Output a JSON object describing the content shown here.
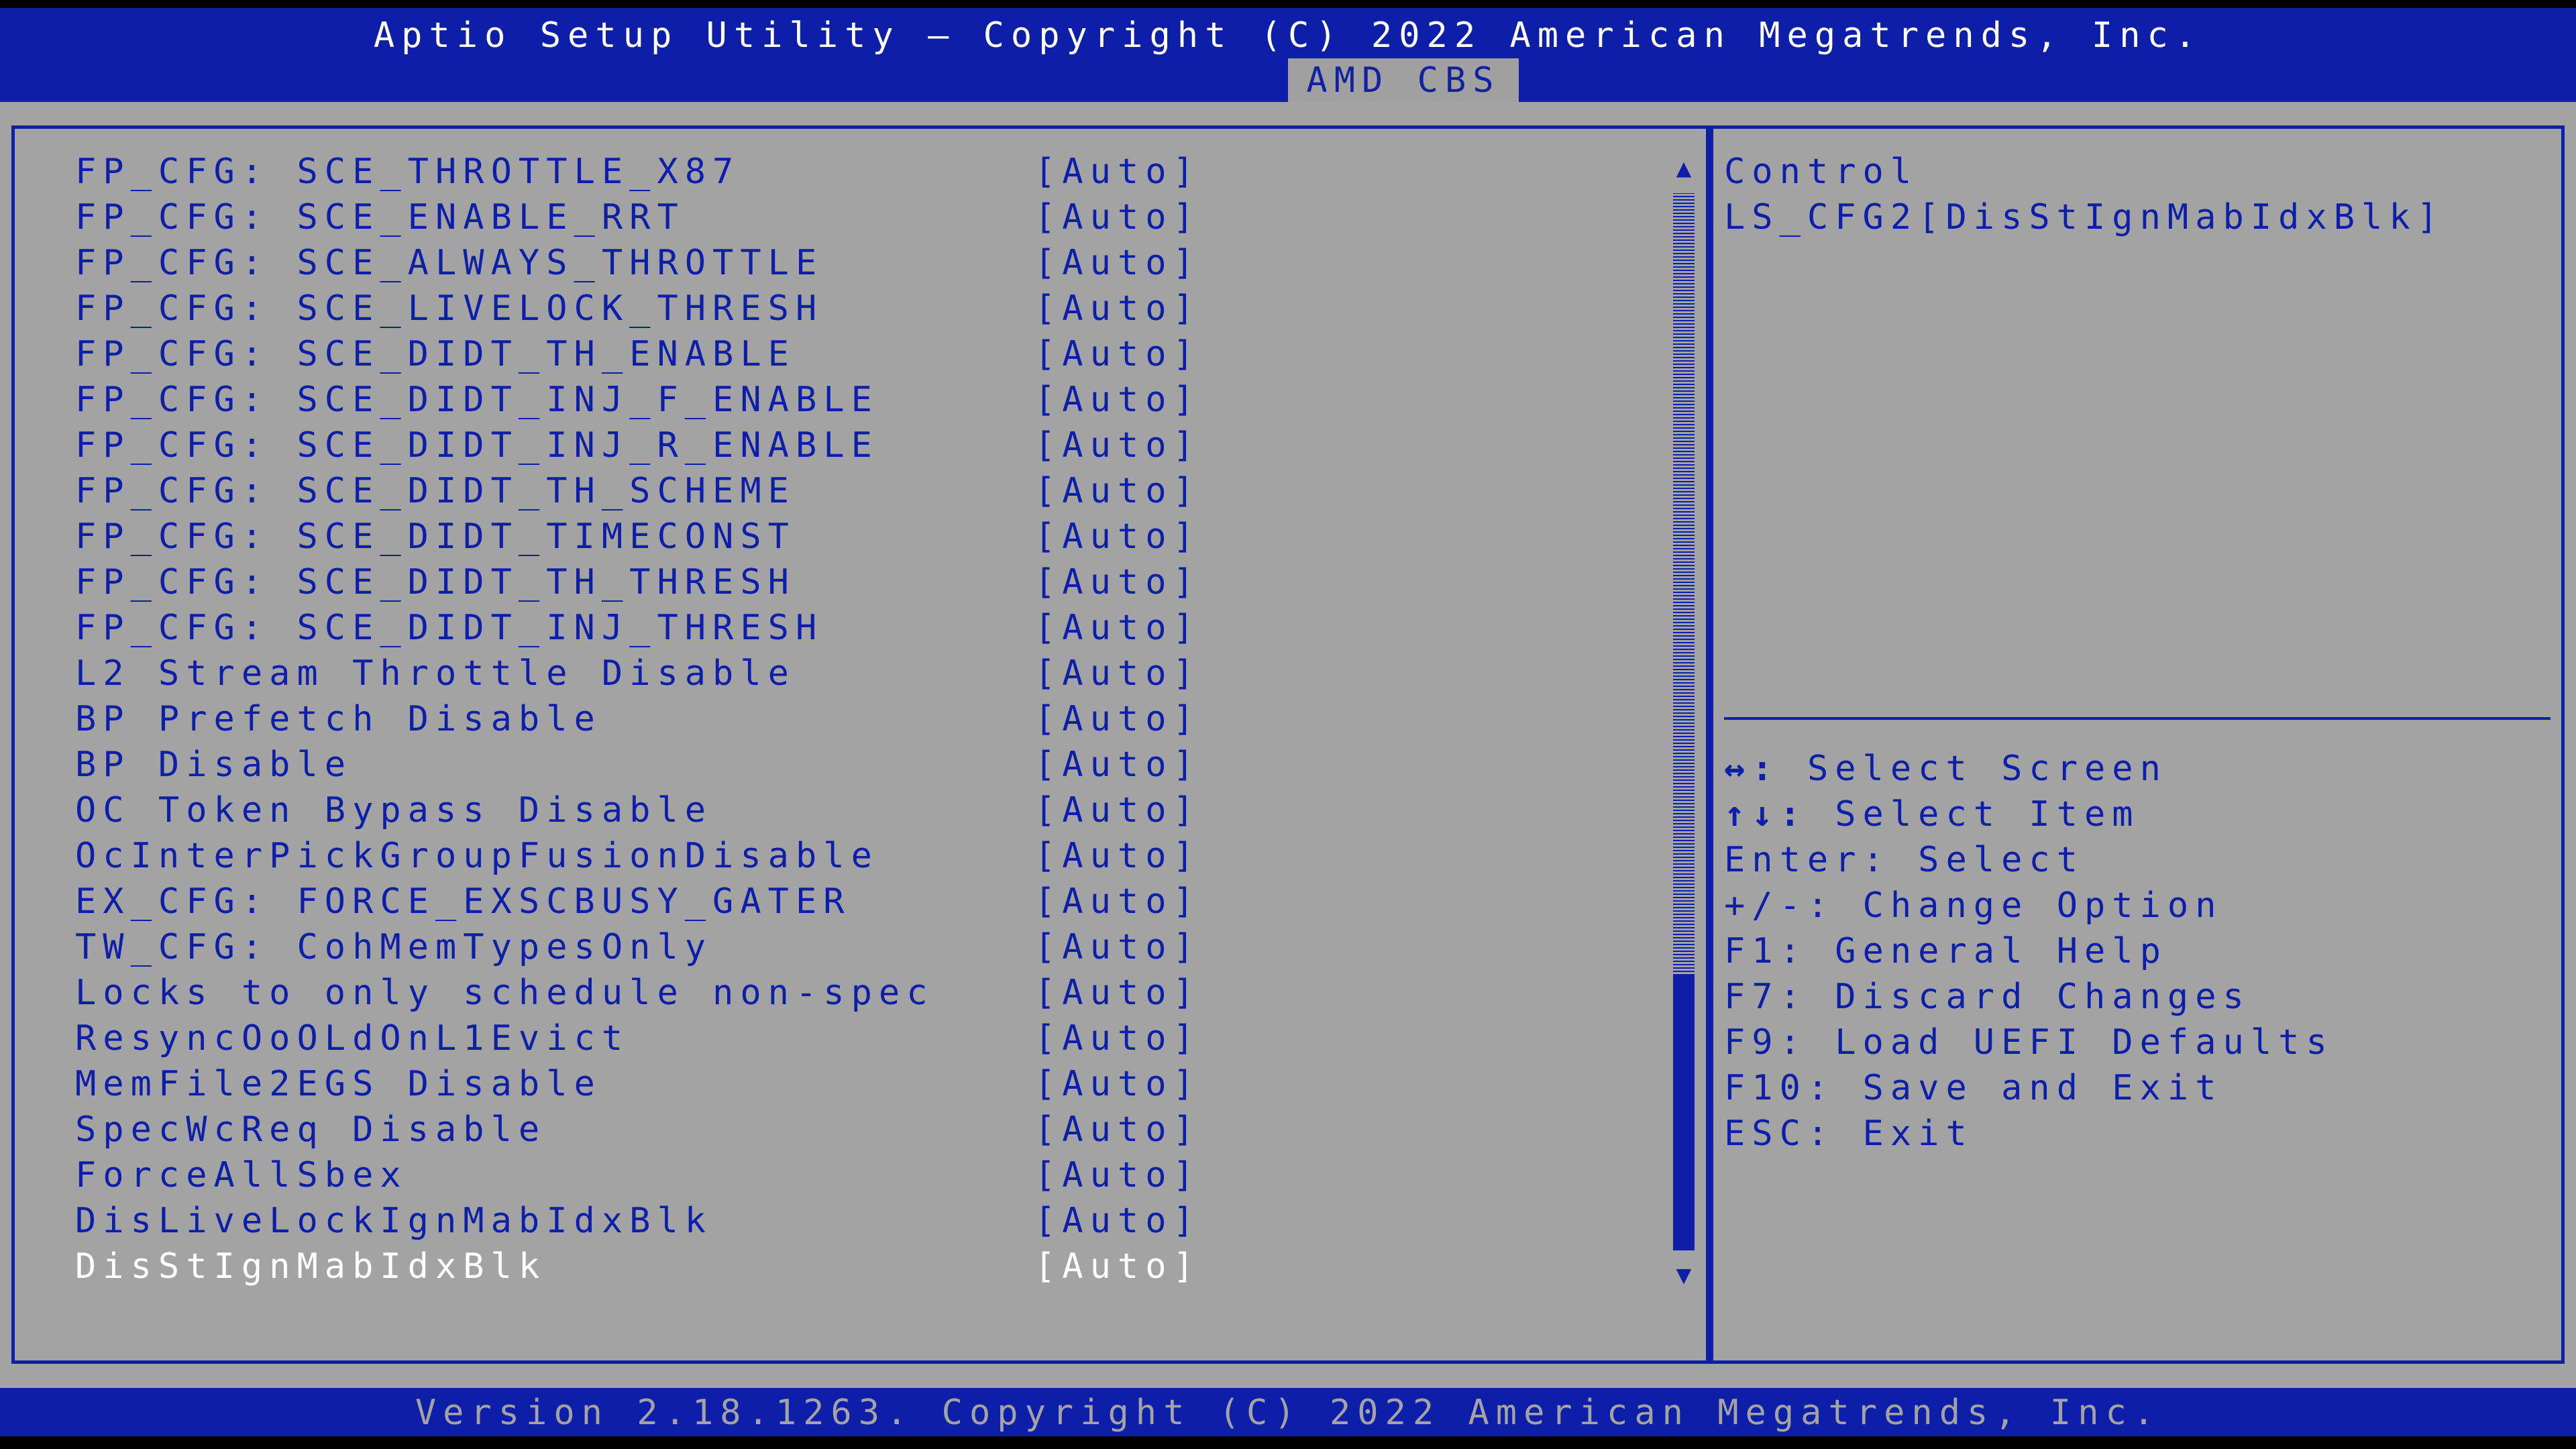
{
  "header": {
    "title": "Aptio Setup Utility – Copyright (C) 2022 American Megatrends, Inc.",
    "active_tab": "AMD CBS"
  },
  "settings": [
    {
      "label": "FP_CFG: SCE_THROTTLE_X87",
      "value": "[Auto]"
    },
    {
      "label": "FP_CFG: SCE_ENABLE_RRT",
      "value": "[Auto]"
    },
    {
      "label": "FP_CFG: SCE_ALWAYS_THROTTLE",
      "value": "[Auto]"
    },
    {
      "label": "FP_CFG: SCE_LIVELOCK_THRESH",
      "value": "[Auto]"
    },
    {
      "label": "FP_CFG: SCE_DIDT_TH_ENABLE",
      "value": "[Auto]"
    },
    {
      "label": "FP_CFG: SCE_DIDT_INJ_F_ENABLE",
      "value": "[Auto]"
    },
    {
      "label": "FP_CFG: SCE_DIDT_INJ_R_ENABLE",
      "value": "[Auto]"
    },
    {
      "label": "FP_CFG: SCE_DIDT_TH_SCHEME",
      "value": "[Auto]"
    },
    {
      "label": "FP_CFG: SCE_DIDT_TIMECONST",
      "value": "[Auto]"
    },
    {
      "label": "FP_CFG: SCE_DIDT_TH_THRESH",
      "value": "[Auto]"
    },
    {
      "label": "FP_CFG: SCE_DIDT_INJ_THRESH",
      "value": "[Auto]"
    },
    {
      "label": "L2 Stream Throttle Disable",
      "value": "[Auto]"
    },
    {
      "label": "BP Prefetch Disable",
      "value": "[Auto]"
    },
    {
      "label": "BP Disable",
      "value": "[Auto]"
    },
    {
      "label": "OC Token Bypass Disable",
      "value": "[Auto]"
    },
    {
      "label": "OcInterPickGroupFusionDisable",
      "value": "[Auto]"
    },
    {
      "label": "EX_CFG: FORCE_EXSCBUSY_GATER",
      "value": "[Auto]"
    },
    {
      "label": "TW_CFG: CohMemTypesOnly",
      "value": "[Auto]"
    },
    {
      "label": "Locks to only schedule non-spec",
      "value": "[Auto]"
    },
    {
      "label": "ResyncOoOLdOnL1Evict",
      "value": "[Auto]"
    },
    {
      "label": "MemFile2EGS Disable",
      "value": "[Auto]"
    },
    {
      "label": "SpecWcReq Disable",
      "value": "[Auto]"
    },
    {
      "label": "ForceAllSbex",
      "value": "[Auto]"
    },
    {
      "label": "DisLiveLockIgnMabIdxBlk",
      "value": "[Auto]"
    },
    {
      "label": "DisStIgnMabIdxBlk",
      "value": "[Auto]"
    }
  ],
  "selected_index": 24,
  "help": {
    "lines": [
      "Control",
      "LS_CFG2[DisStIgnMabIdxBlk]"
    ]
  },
  "keys": [
    {
      "key": "↔:",
      "action": "Select Screen"
    },
    {
      "key": "↑↓:",
      "action": "Select Item"
    },
    {
      "key": "Enter:",
      "action": "Select"
    },
    {
      "key": "+/-:",
      "action": "Change Option"
    },
    {
      "key": "F1:",
      "action": "General Help"
    },
    {
      "key": "F7:",
      "action": "Discard Changes"
    },
    {
      "key": "F9:",
      "action": "Load UEFI Defaults"
    },
    {
      "key": "F10:",
      "action": "Save and Exit"
    },
    {
      "key": "ESC:",
      "action": "Exit"
    }
  ],
  "scrollbar": {
    "up_icon": "▲",
    "down_icon": "▼",
    "position_fraction": 0.72,
    "visible_fraction": 0.26
  },
  "footer": {
    "text": "Version 2.18.1263. Copyright (C) 2022 American Megatrends, Inc."
  },
  "colors": {
    "bar_blue": "#0d1fa8",
    "panel_gray": "#a3a3a3",
    "selected_text": "#ffffff"
  }
}
